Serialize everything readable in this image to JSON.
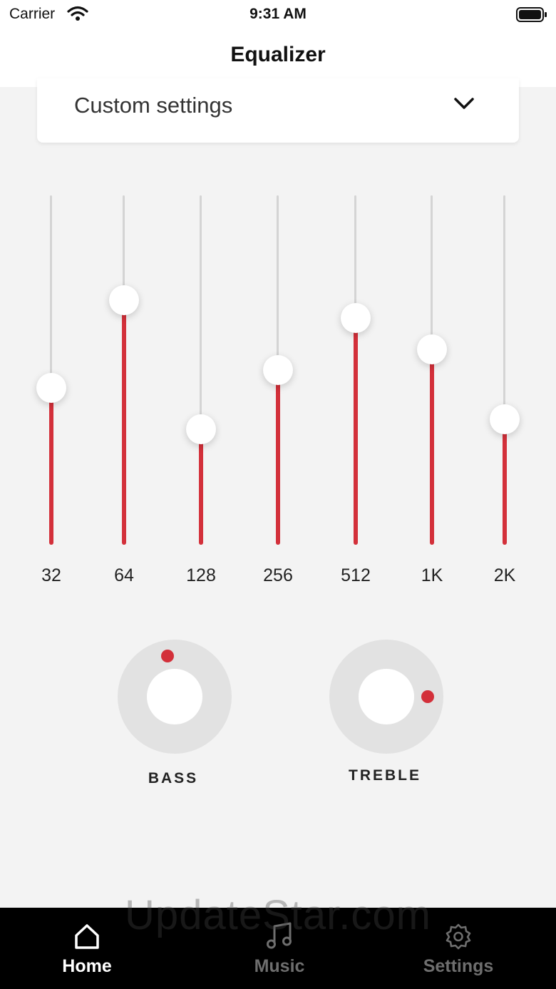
{
  "status_bar": {
    "carrier": "Carrier",
    "time": "9:31 AM",
    "icons": [
      "wifi-icon",
      "battery-icon"
    ]
  },
  "nav": {
    "title": "Equalizer"
  },
  "preset": {
    "selected": "Custom settings",
    "icon": "chevron-down-icon"
  },
  "bands": [
    {
      "label": "32",
      "level": 0.45
    },
    {
      "label": "64",
      "level": 0.7
    },
    {
      "label": "128",
      "level": 0.33
    },
    {
      "label": "256",
      "level": 0.5
    },
    {
      "label": "512",
      "level": 0.65
    },
    {
      "label": "1K",
      "level": 0.56
    },
    {
      "label": "2K",
      "level": 0.36
    }
  ],
  "dials": {
    "bass": {
      "label": "BASS",
      "angle_deg": 350
    },
    "treble": {
      "label": "TREBLE",
      "angle_deg": 90
    }
  },
  "tabs": [
    {
      "label": "Home",
      "icon": "home-icon",
      "active": true
    },
    {
      "label": "Music",
      "icon": "music-icon",
      "active": false
    },
    {
      "label": "Settings",
      "icon": "settings-icon",
      "active": false
    }
  ],
  "watermark": "UpdateStar.com",
  "colors": {
    "accent": "#d3303a",
    "background": "#f3f3f3",
    "tab_bar": "#000000",
    "tab_active": "#ffffff",
    "tab_inactive": "#6e6e6e"
  }
}
